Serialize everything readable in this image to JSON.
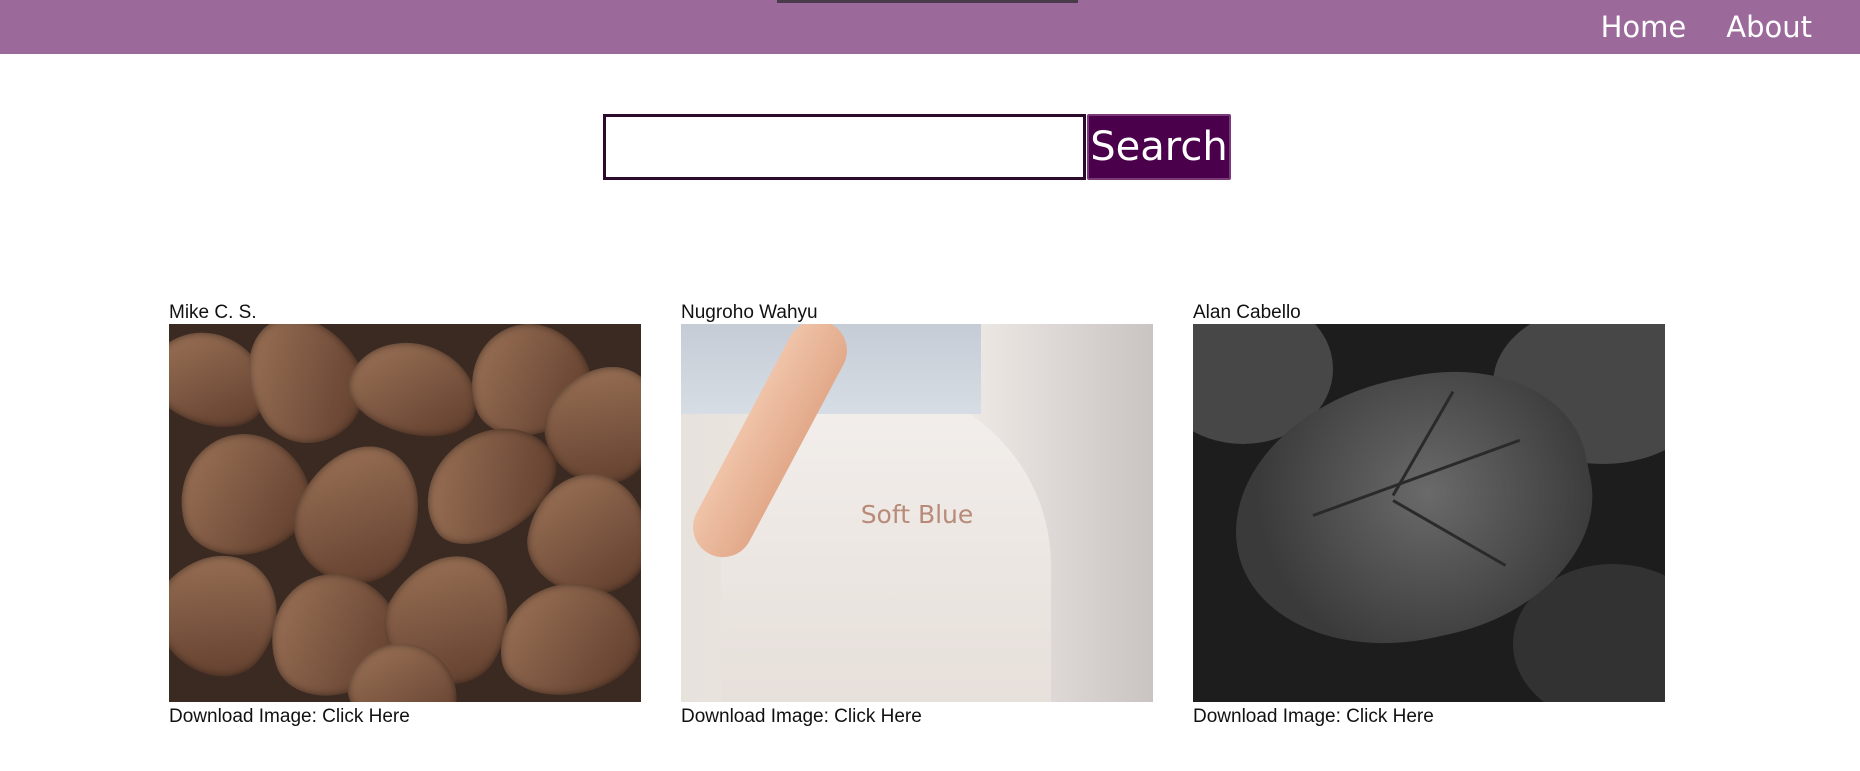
{
  "nav": {
    "home": "Home",
    "about": "About"
  },
  "search": {
    "button_label": "Search",
    "value": "",
    "placeholder": ""
  },
  "gallery": [
    {
      "author": "Mike C. S.",
      "download_prefix": "Download Image: ",
      "download_link": "Click Here",
      "image_desc": "dry brown leaves"
    },
    {
      "author": "Nugroho Wahyu",
      "download_prefix": "Download Image: ",
      "download_link": "Click Here",
      "image_caption": "Soft Blue"
    },
    {
      "author": "Alan Cabello",
      "download_prefix": "Download Image: ",
      "download_link": "Click Here",
      "image_desc": "black and white monstera leaf"
    }
  ],
  "colors": {
    "header": "#9b6a9b",
    "search_button": "#4a004a",
    "search_border": "#2b0a2b"
  }
}
